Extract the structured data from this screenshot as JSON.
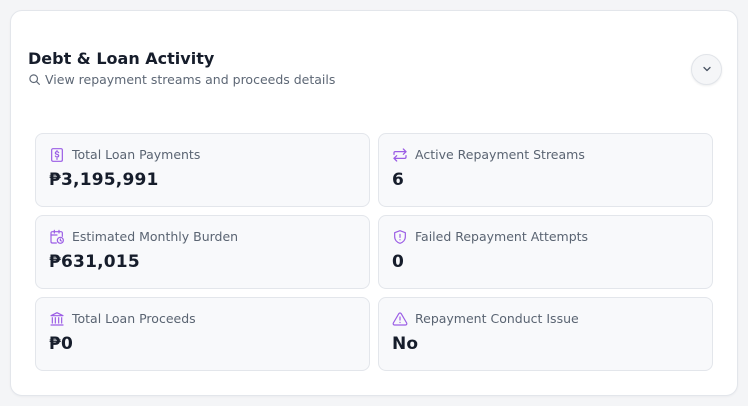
{
  "colors": {
    "accent_icon": "#9b5de5",
    "text_primary": "#161d2b",
    "text_secondary": "#5a6472",
    "card_border": "#e3e6eb"
  },
  "header": {
    "title": "Debt & Loan Activity",
    "subtitle": "View repayment streams and proceeds details",
    "subtitle_icon": "search-icon",
    "toggle_icon": "chevron-down-icon"
  },
  "stats": [
    {
      "label": "Total Loan Payments",
      "value": "₱3,195,991",
      "icon": "dollar-document-icon"
    },
    {
      "label": "Active Repayment Streams",
      "value": "6",
      "icon": "repeat-arrows-icon"
    },
    {
      "label": "Estimated Monthly Burden",
      "value": "₱631,015",
      "icon": "calendar-clock-icon"
    },
    {
      "label": "Failed Repayment Attempts",
      "value": "0",
      "icon": "shield-alert-icon"
    },
    {
      "label": "Total Loan Proceeds",
      "value": "₱0",
      "icon": "bank-icon"
    },
    {
      "label": "Repayment Conduct Issue",
      "value": "No",
      "icon": "warning-triangle-icon"
    }
  ]
}
